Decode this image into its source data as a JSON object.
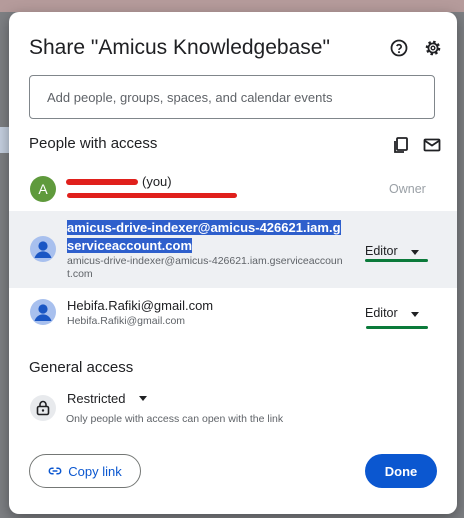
{
  "dialog": {
    "title": "Share \"Amicus Knowledgebase\"",
    "icons": {
      "help": "help-circle-icon",
      "settings": "gear-icon"
    }
  },
  "add_people": {
    "placeholder": "Add people, groups, spaces, and calendar events"
  },
  "people_section": {
    "heading": "People with access",
    "icons": {
      "copy": "copy-emails-icon",
      "email": "mail-icon"
    }
  },
  "people": [
    {
      "avatar_letter": "A",
      "name_suffix": "(you)",
      "role": "Owner"
    },
    {
      "name": "amicus-drive-indexer@amicus-426621.iam.gserviceaccount.com",
      "email": "amicus-drive-indexer@amicus-426621.iam.gserviceaccount.com",
      "role": "Editor"
    },
    {
      "name": "Hebifa.Rafiki@gmail.com",
      "email": "Hebifa.Rafiki@gmail.com",
      "role": "Editor"
    }
  ],
  "general_access": {
    "heading": "General access",
    "level": "Restricted",
    "description": "Only people with access can open with the link"
  },
  "footer": {
    "copy_link": "Copy link",
    "done": "Done"
  },
  "colors": {
    "primary": "#0b57d0",
    "redaction": "#e0201c",
    "annotation": "#0b7a3a"
  }
}
